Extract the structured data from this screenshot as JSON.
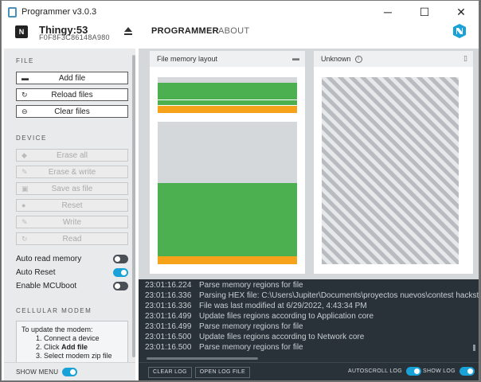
{
  "window": {
    "title": "Programmer v3.0.3",
    "controls": {
      "minimize": "─",
      "maximize": "☐",
      "close": "✕"
    }
  },
  "header": {
    "device_chip": "N",
    "device_name": "Thingy:53",
    "device_serial": "F0F8F3C86148A980",
    "tabs": [
      {
        "label": "PROGRAMMER",
        "active": true
      },
      {
        "label": "ABOUT",
        "active": false
      }
    ]
  },
  "sidebar": {
    "file_section": "FILE",
    "file_buttons": [
      {
        "label": "Add file",
        "icon": "folder-open-icon"
      },
      {
        "label": "Reload files",
        "icon": "reload-icon"
      },
      {
        "label": "Clear files",
        "icon": "minus-circle-icon"
      }
    ],
    "device_section": "DEVICE",
    "device_buttons": [
      {
        "label": "Erase all",
        "icon": "eraser-icon"
      },
      {
        "label": "Erase & write",
        "icon": "pencil-icon"
      },
      {
        "label": "Save as file",
        "icon": "floppy-icon"
      },
      {
        "label": "Reset",
        "icon": "record-icon"
      },
      {
        "label": "Write",
        "icon": "pencil-icon"
      },
      {
        "label": "Read",
        "icon": "reload-icon"
      }
    ],
    "toggles": [
      {
        "label": "Auto read memory",
        "on": false
      },
      {
        "label": "Auto Reset",
        "on": true
      },
      {
        "label": "Enable MCUboot",
        "on": false
      }
    ],
    "cellular_section": "CELLULAR MODEM",
    "modem": {
      "intro": "To update the modem:",
      "step1": "1. Connect a device",
      "step2_prefix": "2. Click ",
      "step2_bold": "Add file",
      "step3": "3. Select modem zip file"
    },
    "show_menu": {
      "label": "SHOW MENU",
      "on": true
    }
  },
  "main": {
    "file_card": {
      "title": "File memory layout"
    },
    "device_card": {
      "title": "Unknown"
    }
  },
  "log": {
    "lines": [
      {
        "time": "23:01:16.224",
        "text": "Parse memory regions for file"
      },
      {
        "time": "23:01:16.336",
        "text": "Parsing HEX file: C:\\Users\\Jupiter\\Documents\\proyectos nuevos\\contest hackster\\"
      },
      {
        "time": "23:01:16.336",
        "text": "File was last modified at 6/29/2022, 4:43:34 PM"
      },
      {
        "time": "23:01:16.499",
        "text": "Update files regions according to Application core"
      },
      {
        "time": "23:01:16.499",
        "text": "Parse memory regions for file"
      },
      {
        "time": "23:01:16.500",
        "text": "Update files regions according to Network core"
      },
      {
        "time": "23:01:16.500",
        "text": "Parse memory regions for file"
      }
    ],
    "clear_label": "CLEAR LOG",
    "open_label": "OPEN LOG FILE",
    "autoscroll": {
      "label": "AUTOSCROLL LOG",
      "on": true
    },
    "show_log": {
      "label": "SHOW LOG",
      "on": true
    }
  },
  "colors": {
    "accent": "#18a2d7",
    "region_green": "#4caf50",
    "region_orange": "#f7a21b",
    "log_bg": "#283238"
  }
}
